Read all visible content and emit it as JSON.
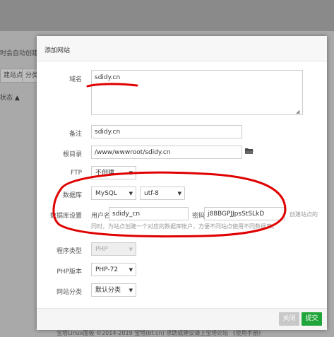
{
  "background": {
    "hint_text": "时会自动创建权",
    "btn_add_site": "建站点",
    "btn_category": "分类",
    "col_status": "状态",
    "footer": "宝塔Linux面板 ©2014-2019 宝塔(bt.cn)   求助或建议请上宝塔论坛   《使用手册》"
  },
  "modal": {
    "title": "添加网站",
    "domain": {
      "label": "域名",
      "value": "sdidy.cn"
    },
    "remark": {
      "label": "备注",
      "value": "sdidy.cn"
    },
    "root": {
      "label": "根目录",
      "value": "/www/wwwroot/sdidy.cn"
    },
    "ftp": {
      "label": "FTP",
      "value": "不创建"
    },
    "database": {
      "label": "数据库",
      "type": "MySQL",
      "charset": "utf-8"
    },
    "db_settings": {
      "label": "数据库设置",
      "user_label": "用户名",
      "user_value": "sdidy_cn",
      "pass_label": "密码",
      "pass_value": "j88BGPJJpsStSLkD",
      "side_note": "创建站点的",
      "hint": "同时，为站点创建一个对应的数据库帐户，方便不同站点使用不同数据库。"
    },
    "program_type": {
      "label": "程序类型",
      "value": "PHP"
    },
    "php_version": {
      "label": "PHP版本",
      "value": "PHP-72"
    },
    "site_category": {
      "label": "网站分类",
      "value": "默认分类"
    },
    "cancel_label": "关闭",
    "submit_label": "提交"
  },
  "colors": {
    "accent_green": "#20a53a",
    "annotation_red": "#e00000"
  }
}
